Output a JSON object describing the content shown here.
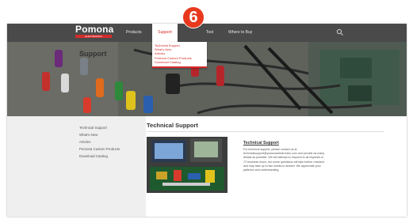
{
  "brand": {
    "logo_word": "Pomona",
    "logo_tagline": "ELECTRONICS"
  },
  "nav": {
    "items": [
      {
        "label": "Products"
      },
      {
        "label": "Support"
      },
      {
        "label": "Tool"
      },
      {
        "label": "Where to Buy"
      }
    ],
    "active_index": 1
  },
  "dropdown": {
    "items": [
      {
        "label": "Technical Support"
      },
      {
        "label": "What's New"
      },
      {
        "label": "Articles"
      },
      {
        "label": "Pomona Custom Products"
      },
      {
        "label": "Download Catalog"
      }
    ]
  },
  "step_badge": {
    "number": "6"
  },
  "sidebar": {
    "title": "Support",
    "items": [
      {
        "label": "Technical Support"
      },
      {
        "label": "What's New"
      },
      {
        "label": "Articles"
      },
      {
        "label": "Pomona Custom Products"
      },
      {
        "label": "Download Catalog"
      }
    ]
  },
  "content": {
    "page_title": "Technical Support",
    "heading": "Technical Support",
    "paragraph": "For technical support, please contact us at technicalsupport@pomonaelectronics.com and provide as many details as possible. We will attempt to respond to all requests in 72 business hours, but some questions will take further research and may take up to two weeks to answer. We appreciate your patience and understanding."
  },
  "colors": {
    "accent": "#d52b2b",
    "badge": "#e8391e",
    "navbar": "#4a4a4a",
    "sidebar_bg": "#efefef"
  },
  "icons": {
    "search": "search-icon"
  }
}
